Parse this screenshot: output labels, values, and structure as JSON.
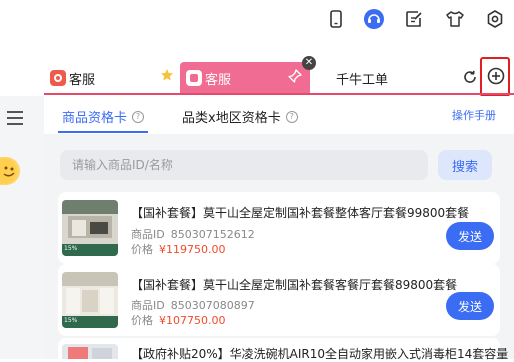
{
  "colors": {
    "accent_blue": "#3b6cf4",
    "tab_pink": "#f06c92",
    "price_red": "#f24b2b",
    "highlight_red": "#e02020"
  },
  "toolbar": {
    "icons": [
      "phone-icon",
      "headset-icon",
      "edit-icon",
      "shirt-icon",
      "settings-icon"
    ]
  },
  "tabs": [
    {
      "label": "客服",
      "icon": "customer-service-app-icon"
    },
    {
      "label": "客服",
      "icon": "customer-service-app-icon",
      "active": true
    },
    {
      "label": "千牛工单"
    }
  ],
  "subtabs": {
    "items": [
      {
        "label": "商品资格卡",
        "active": true
      },
      {
        "label": "品类x地区资格卡"
      }
    ],
    "help_symbol": "?",
    "manual_label": "操作手册"
  },
  "search": {
    "placeholder": "请输入商品ID/名称",
    "button_label": "搜索"
  },
  "products": [
    {
      "title": "【国补套餐】莫干山全屋定制国补套餐整体客厅套餐99800套餐",
      "id_label": "商品ID",
      "id_value": "850307152612",
      "price_label": "价格",
      "price_value": "¥119750.00",
      "send_label": "发送"
    },
    {
      "title": "【国补套餐】莫干山全屋定制国补套餐客餐厅套餐89800套餐",
      "id_label": "商品ID",
      "id_value": "850307080897",
      "price_label": "价格",
      "price_value": "¥107750.00",
      "send_label": "发送"
    },
    {
      "title": "【政府补贴20%】华凌洗碗机AIR10全自动家用嵌入式消毒柜14套容量"
    }
  ],
  "thumb_badge": "15%"
}
